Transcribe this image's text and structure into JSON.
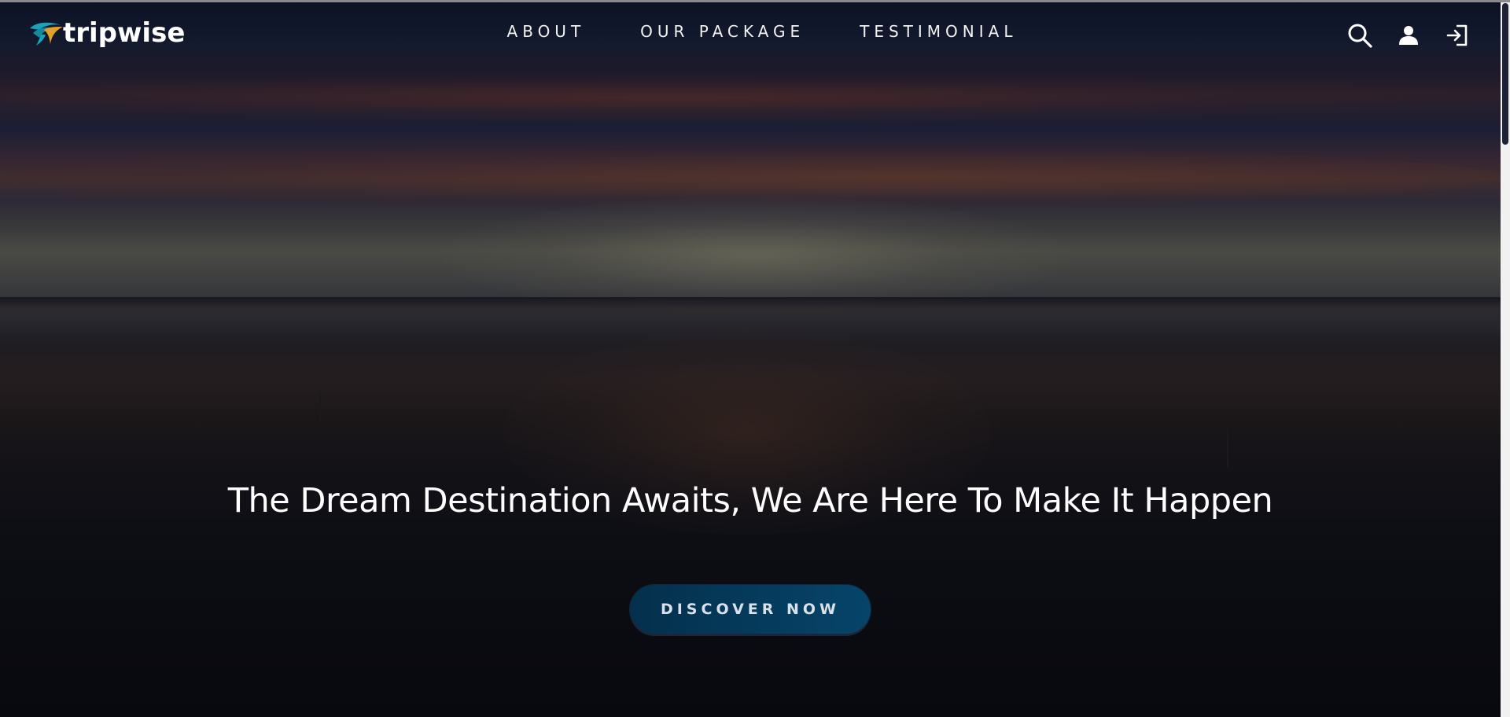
{
  "brand": {
    "name": "tripwise"
  },
  "nav": {
    "items": [
      {
        "label": "ABOUT"
      },
      {
        "label": "OUR PACKAGE"
      },
      {
        "label": "TESTIMONIAL"
      }
    ]
  },
  "header_icons": [
    "search-icon",
    "user-icon",
    "login-icon"
  ],
  "hero": {
    "headline": "The Dream Destination Awaits, We Are Here To Make It Happen",
    "cta_label": "DISCOVER NOW"
  },
  "colors": {
    "cta_start": "#04304c",
    "cta_end": "#06446a",
    "logo_teal": "#1aa3b8",
    "logo_gold": "#e0a32a",
    "text": "#ffffff"
  }
}
